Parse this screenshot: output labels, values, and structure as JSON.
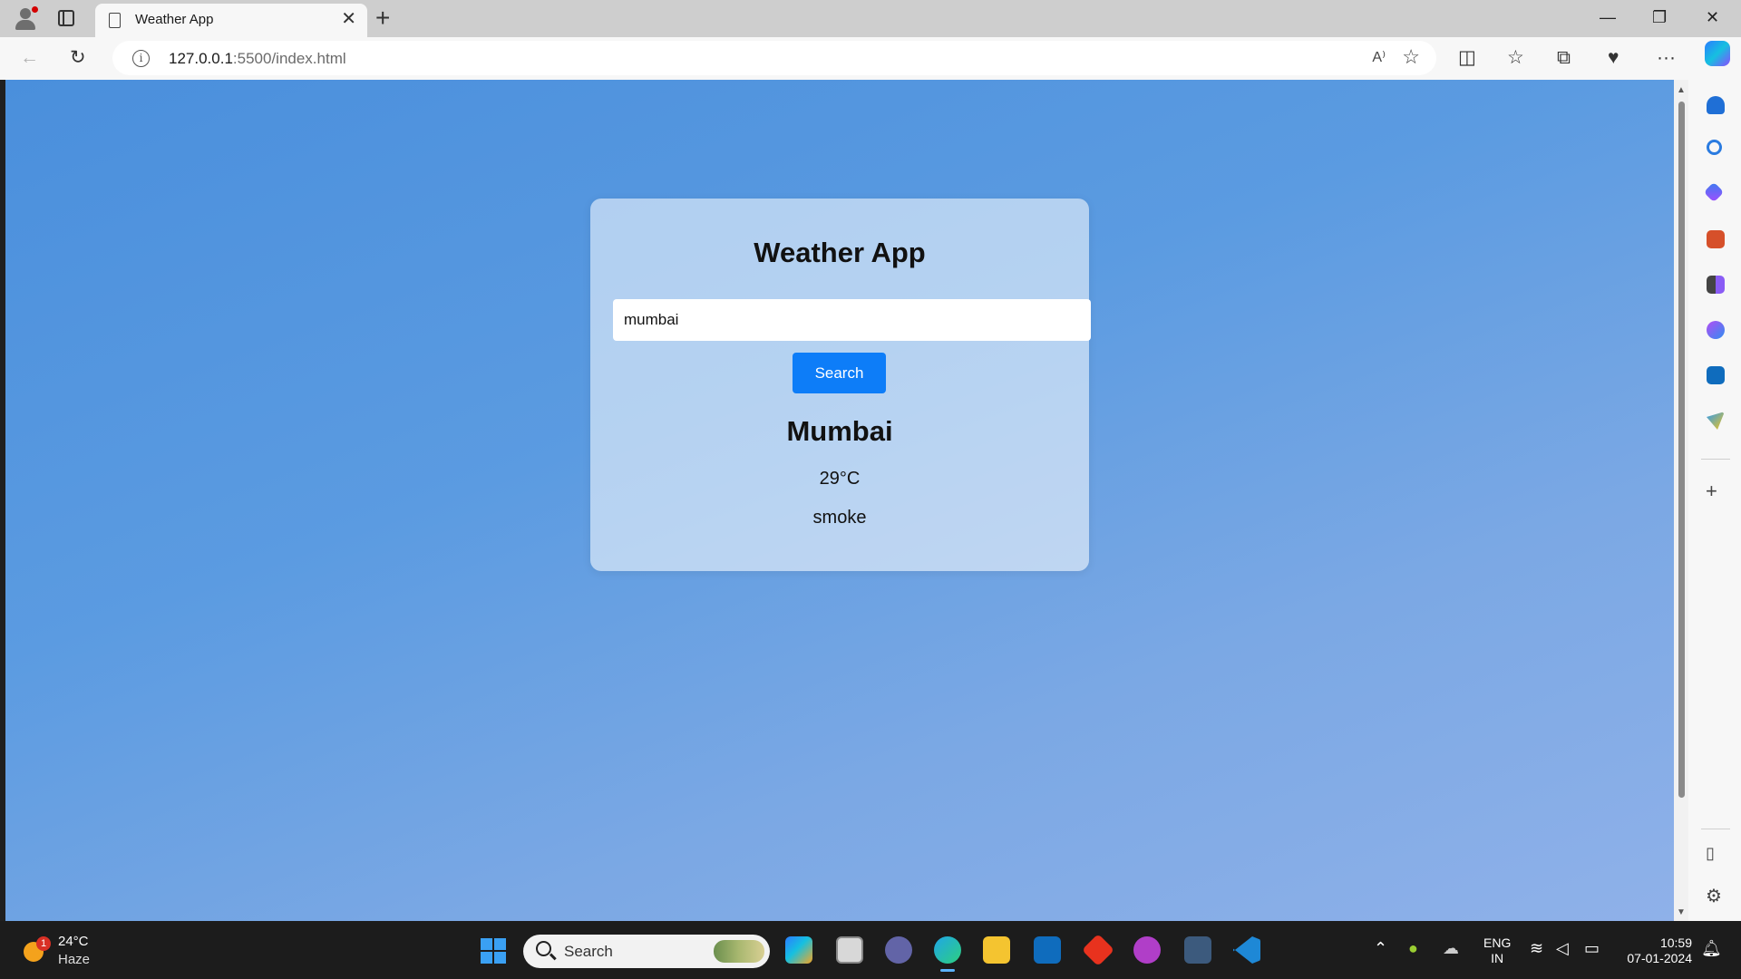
{
  "browser": {
    "tab_title": "Weather App",
    "url_host": "127.0.0.1",
    "url_rest": ":5500/index.html"
  },
  "app": {
    "title": "Weather App",
    "search_value": "mumbai",
    "search_button": "Search",
    "city": "Mumbai",
    "temperature": "29°C",
    "description": "smoke"
  },
  "taskbar": {
    "weather_temp": "24°C",
    "weather_desc": "Haze",
    "weather_badge": "1",
    "search_label": "Search",
    "lang_top": "ENG",
    "lang_bottom": "IN",
    "time": "10:59",
    "date": "07-01-2024"
  },
  "colors": {
    "accent_button": "#0d7df8",
    "page_bg_start": "#4a8fdc",
    "page_bg_end": "#8fb1e9"
  }
}
